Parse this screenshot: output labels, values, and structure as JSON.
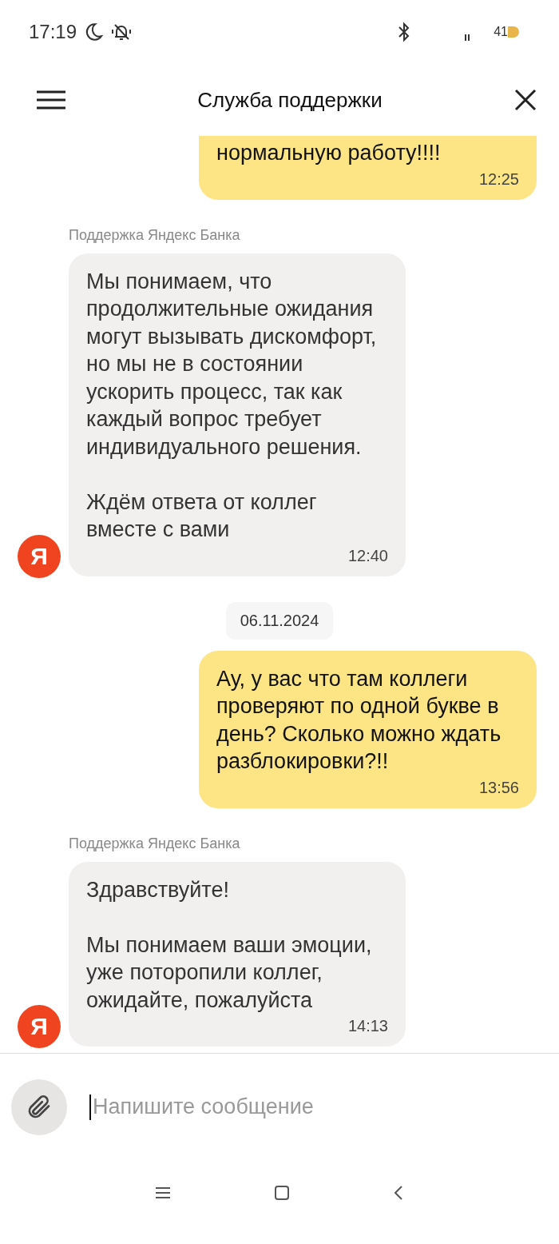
{
  "status_bar": {
    "time": "17:19",
    "battery": "41"
  },
  "header": {
    "title": "Служба поддержки"
  },
  "messages": [
    {
      "kind": "outgoing",
      "text": "нормальную работу!!!!",
      "time": "12:25"
    },
    {
      "kind": "incoming",
      "sender": "Поддержка Яндекс Банка",
      "avatar": "Я",
      "text": "Мы понимаем, что продолжительные ожидания могут вызывать дискомфорт, но мы не в состоянии ускорить процесс, так как каждый вопрос требует индивидуального решения.\n\nЖдём ответа от коллег вместе с вами",
      "time": "12:40"
    },
    {
      "kind": "date",
      "text": "06.11.2024"
    },
    {
      "kind": "outgoing",
      "text": "Ау, у вас что там коллеги проверяют по одной букве в день? Сколько можно ждать разблокировки?!!",
      "time": "13:56"
    },
    {
      "kind": "incoming",
      "sender": "Поддержка Яндекс Банка",
      "avatar": "Я",
      "text": "Здравствуйте!\n\nМы понимаем ваши эмоции, уже поторопили коллег, ожидайте, пожалуйста",
      "time": "14:13"
    }
  ],
  "composer": {
    "placeholder": "Напишите сообщение"
  }
}
